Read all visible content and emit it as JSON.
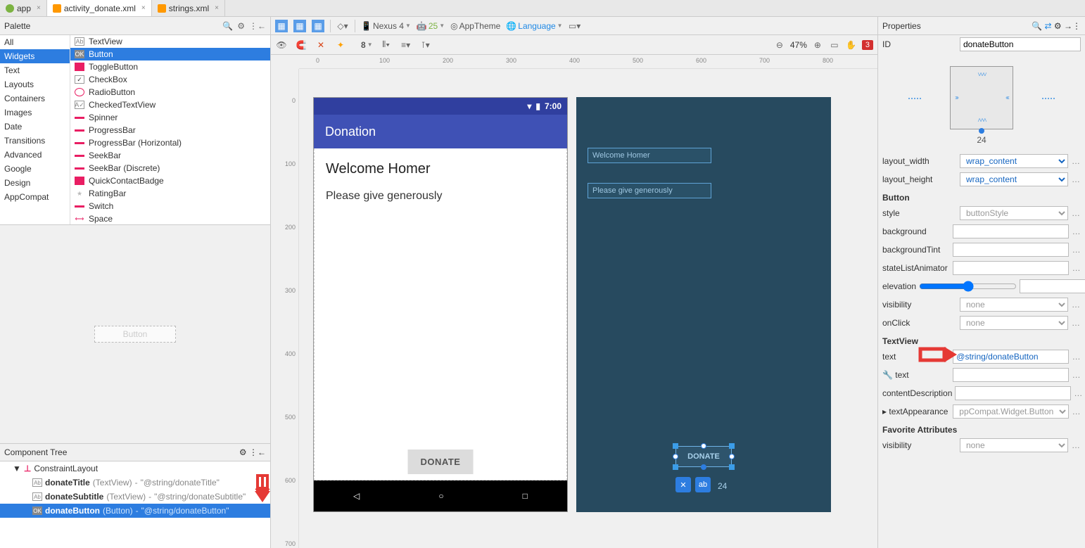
{
  "tabs": [
    {
      "label": "app"
    },
    {
      "label": "activity_donate.xml"
    },
    {
      "label": "strings.xml"
    }
  ],
  "palette": {
    "title": "Palette",
    "categories": [
      "All",
      "Widgets",
      "Text",
      "Layouts",
      "Containers",
      "Images",
      "Date",
      "Transitions",
      "Advanced",
      "Google",
      "Design",
      "AppCompat"
    ],
    "items": [
      "TextView",
      "Button",
      "ToggleButton",
      "CheckBox",
      "RadioButton",
      "CheckedTextView",
      "Spinner",
      "ProgressBar",
      "ProgressBar (Horizontal)",
      "SeekBar",
      "SeekBar (Discrete)",
      "QuickContactBadge",
      "RatingBar",
      "Switch",
      "Space"
    ]
  },
  "preview_label": "BUTTON",
  "component_tree": {
    "title": "Component Tree",
    "root": "ConstraintLayout",
    "children": [
      {
        "name": "donateTitle",
        "type": "(TextView)",
        "res": "\"@string/donateTitle\""
      },
      {
        "name": "donateSubtitle",
        "type": "(TextView)",
        "res": "\"@string/donateSubtitle\""
      },
      {
        "name": "donateButton",
        "type": "(Button)",
        "res": "\"@string/donateButton\""
      }
    ]
  },
  "toolbar": {
    "device": "Nexus 4",
    "api": "25",
    "theme": "AppTheme",
    "lang": "Language",
    "zoom": "47%",
    "errors": "3",
    "default_margin": "8"
  },
  "phone": {
    "time": "7:00",
    "app_title": "Donation",
    "title": "Welcome Homer",
    "subtitle": "Please give generously",
    "button": "DONATE"
  },
  "blueprint": {
    "title": "Welcome Homer",
    "subtitle": "Please give generously",
    "button": "DONATE",
    "margin": "24"
  },
  "properties": {
    "title": "Properties",
    "id": "donateButton",
    "constraint_bottom": "24",
    "layout_width": "wrap_content",
    "layout_height": "wrap_content",
    "section_button": "Button",
    "style": "buttonStyle",
    "background": "",
    "backgroundTint": "",
    "stateListAnimator": "",
    "elevation": "",
    "visibility": "none",
    "onClick": "none",
    "section_textview": "TextView",
    "text": "@string/donateButton",
    "text2": "",
    "contentDescription": "",
    "textAppearance": "ppCompat.Widget.Button",
    "section_fav": "Favorite Attributes",
    "fav_visibility": "none",
    "lab_id": "ID",
    "lab_lw": "layout_width",
    "lab_lh": "layout_height",
    "lab_style": "style",
    "lab_bg": "background",
    "lab_bgt": "backgroundTint",
    "lab_sla": "stateListAnimator",
    "lab_elev": "elevation",
    "lab_vis": "visibility",
    "lab_oc": "onClick",
    "lab_text": "text",
    "lab_text2": "text",
    "lab_cd": "contentDescription",
    "lab_ta": "textAppearance",
    "lab_favvis": "visibility"
  },
  "ruler_h": [
    0,
    100,
    200,
    300,
    400,
    500,
    600,
    700,
    800
  ],
  "ruler_v": [
    0,
    100,
    200,
    300,
    400,
    500,
    600,
    700
  ]
}
